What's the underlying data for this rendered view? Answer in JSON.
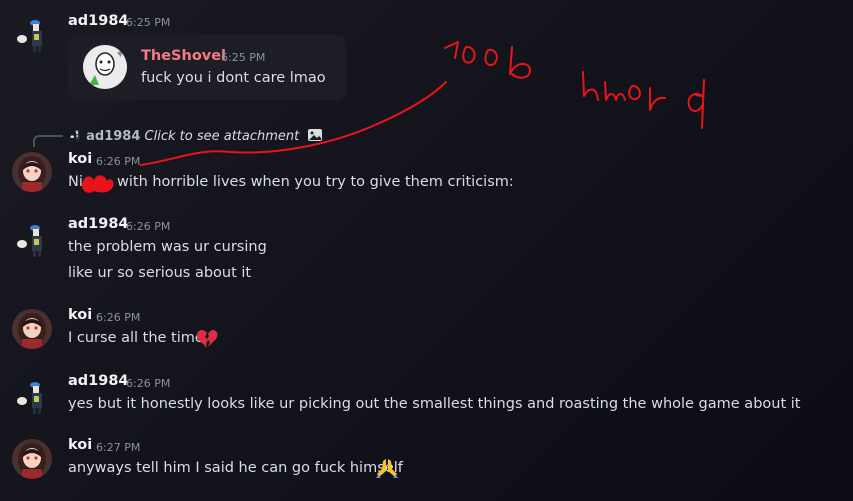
{
  "colors": {
    "embed_name": "#f47b83",
    "heart": "#dd2e44",
    "scribble": "#e8141a"
  },
  "embed": {
    "author": "TheShovel",
    "time": "6:25 PM",
    "text": "fuck you i dont care lmao"
  },
  "reply": {
    "author": "ad1984",
    "text": "Click to see attachment",
    "icon": "image-icon"
  },
  "messages": [
    {
      "author": "ad1984",
      "time": "6:25 PM"
    },
    {
      "author": "koi",
      "time": "6:26 PM",
      "lines": [
        "Ni",
        "with horrible lives when you try to give them criticism:"
      ]
    },
    {
      "author": "ad1984",
      "time": "6:26 PM",
      "lines": [
        "the problem was ur cursing",
        "like ur so serious about it"
      ]
    },
    {
      "author": "koi",
      "time": "6:26 PM",
      "lines": [
        "I curse all the time"
      ],
      "emoji": "broken-heart-icon"
    },
    {
      "author": "ad1984",
      "time": "6:26 PM",
      "lines": [
        "yes but it honestly looks like ur picking out the smallest things and roasting the whole game about it"
      ]
    },
    {
      "author": "koi",
      "time": "6:27 PM",
      "lines": [
        "anyways tell him I said he can go fuck himself"
      ],
      "emoji": "folded-hands-icon"
    }
  ]
}
